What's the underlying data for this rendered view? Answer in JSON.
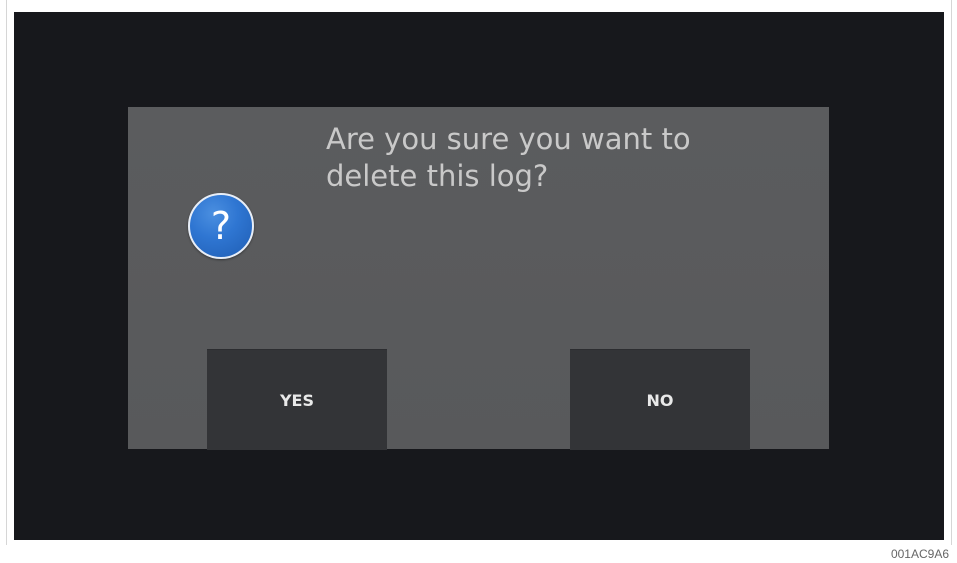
{
  "dialog": {
    "message_line1": "Are you sure you want to",
    "message_line2": "delete this log?",
    "icon": "question-icon",
    "icon_glyph": "?",
    "icon_color": "#2f76d2",
    "yes_label": "YES",
    "no_label": "NO"
  },
  "figure_code": "001AC9A6",
  "colors": {
    "screen_background": "#17181c",
    "dialog_background": "#5a5b5d",
    "button_background": "#333437",
    "message_text": "#c9c9c9"
  }
}
